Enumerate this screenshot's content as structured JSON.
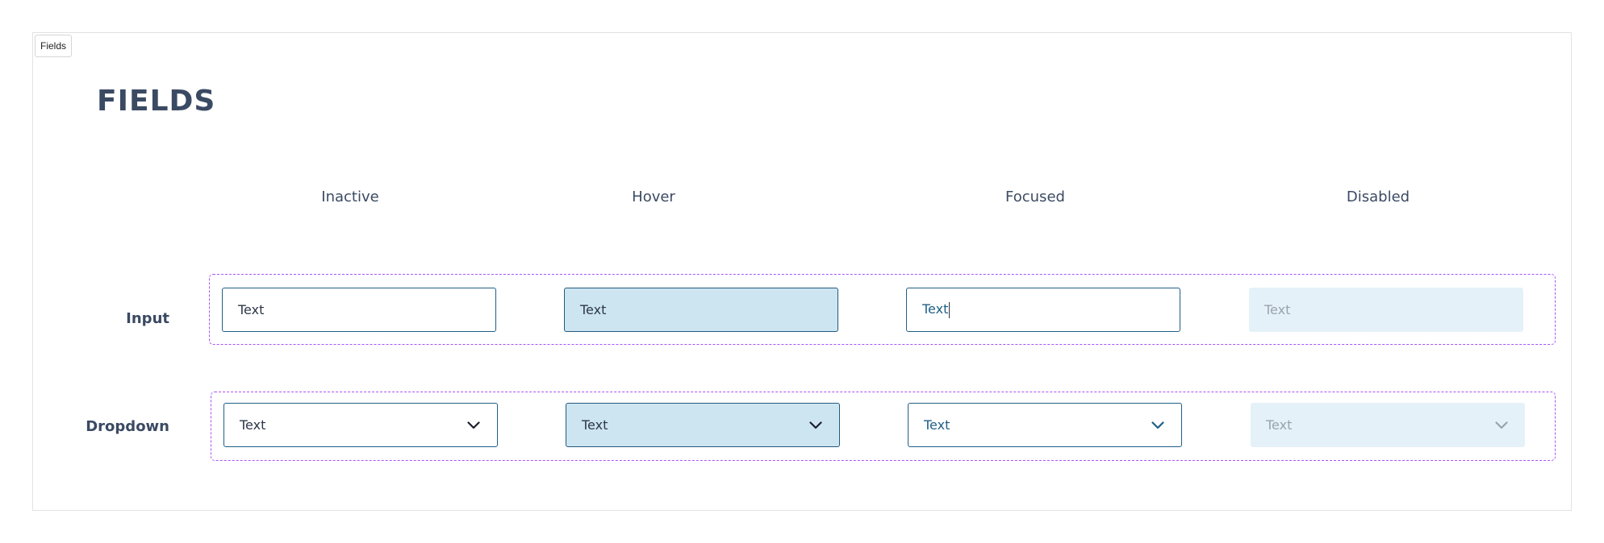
{
  "frame_tag": "Fields",
  "page_title": "FIELDS",
  "states": [
    "Inactive",
    "Hover",
    "Focused",
    "Disabled"
  ],
  "rows": {
    "input": {
      "label": "Input",
      "fields": [
        {
          "state": "Inactive",
          "value": "Text"
        },
        {
          "state": "Hover",
          "value": "Text"
        },
        {
          "state": "Focused",
          "value": "Text"
        },
        {
          "state": "Disabled",
          "value": "Text"
        }
      ]
    },
    "dropdown": {
      "label": "Dropdown",
      "fields": [
        {
          "state": "Inactive",
          "value": "Text",
          "icon": "chevron-down-icon"
        },
        {
          "state": "Hover",
          "value": "Text",
          "icon": "chevron-down-icon"
        },
        {
          "state": "Focused",
          "value": "Text",
          "icon": "chevron-down-icon"
        },
        {
          "state": "Disabled",
          "value": "Text",
          "icon": "chevron-down-icon"
        }
      ]
    }
  },
  "colors": {
    "border": "#1f5f87",
    "hover_fill": "#cde5f1",
    "disabled_fill": "#e5f1f8",
    "group_outline": "#a855f7",
    "heading_text": "#3b4a63"
  }
}
